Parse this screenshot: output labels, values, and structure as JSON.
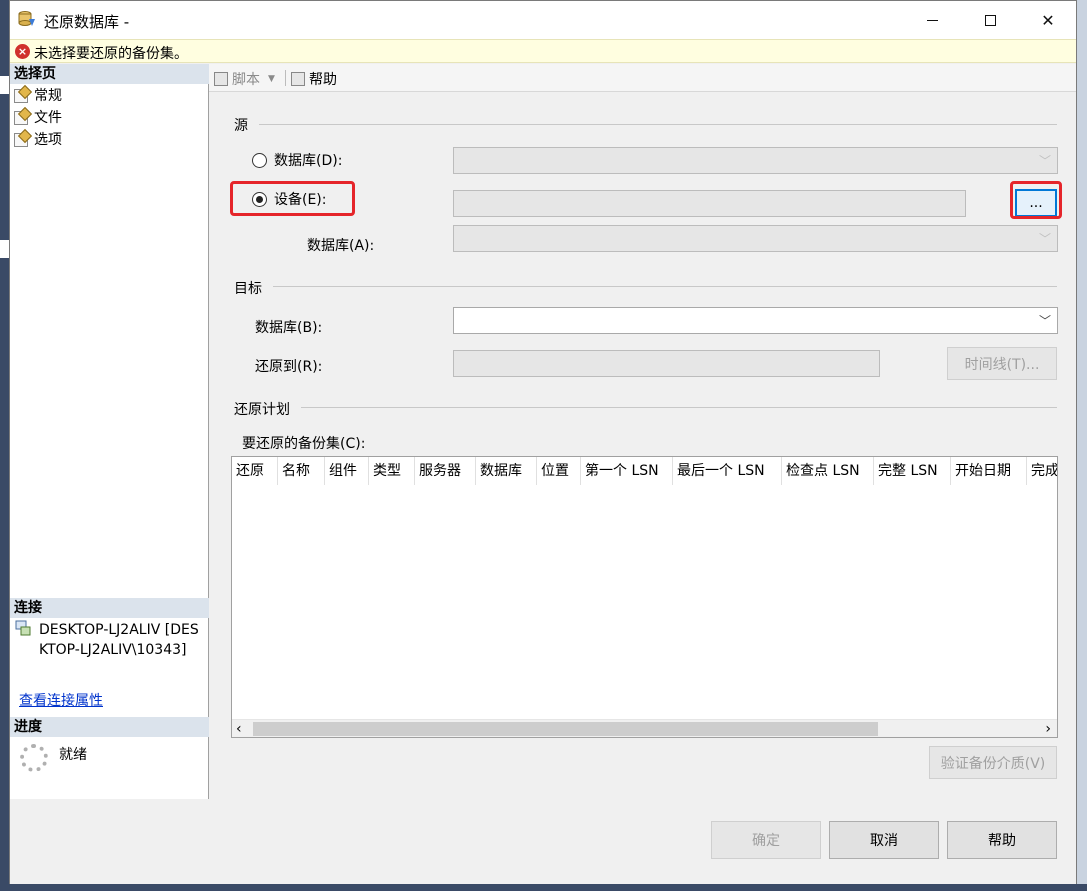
{
  "window": {
    "title": "还原数据库 -",
    "error_message": "未选择要还原的备份集。"
  },
  "left_panel": {
    "select_page_header": "选择页",
    "pages": [
      "常规",
      "文件",
      "选项"
    ],
    "connection_header": "连接",
    "connection_text": "DESKTOP-LJ2ALIV [DESKTOP-LJ2ALIV\\10343]",
    "view_connection_link": "查看连接属性",
    "progress_header": "进度",
    "progress_status": "就绪"
  },
  "toolbar": {
    "script_label": "脚本",
    "help_label": "帮助"
  },
  "source": {
    "section_title": "源",
    "database_radio": "数据库(D):",
    "device_radio": "设备(E):",
    "browse_button": "...",
    "database_label": "数据库(A):",
    "selected": "device"
  },
  "destination": {
    "section_title": "目标",
    "database_label": "数据库(B):",
    "restore_to_label": "还原到(R):",
    "timeline_button": "时间线(T)..."
  },
  "plan": {
    "section_title": "还原计划",
    "backup_sets_label": "要还原的备份集(C):",
    "columns": [
      "还原",
      "名称",
      "组件",
      "类型",
      "服务器",
      "数据库",
      "位置",
      "第一个 LSN",
      "最后一个 LSN",
      "检查点 LSN",
      "完整 LSN",
      "开始日期",
      "完成"
    ],
    "verify_button": "验证备份介质(V)"
  },
  "footer": {
    "ok_button": "确定",
    "cancel_button": "取消",
    "help_button": "帮助"
  },
  "colors": {
    "highlight": "#e5252a",
    "error_icon": "#d0312d",
    "link": "#0033cc"
  }
}
